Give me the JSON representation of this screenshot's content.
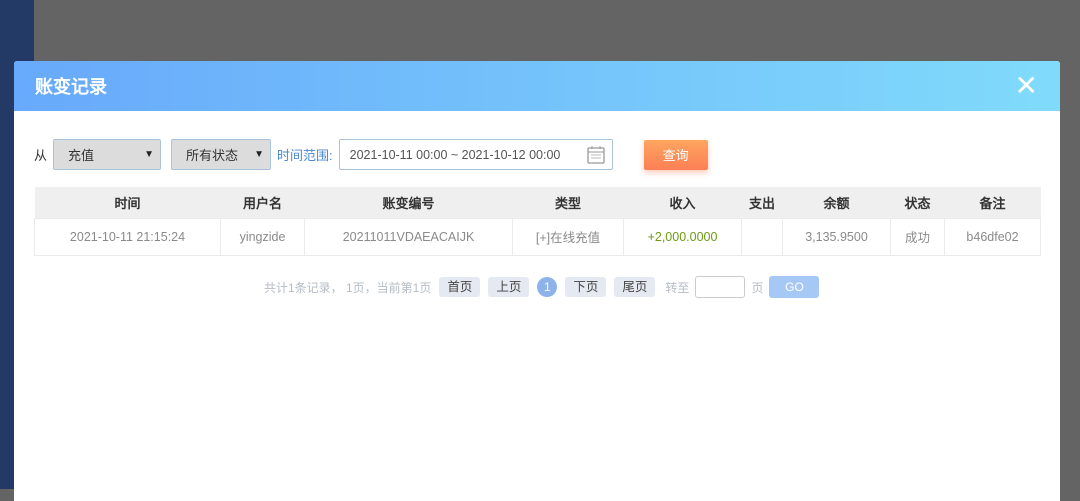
{
  "modal": {
    "title": "账变记录",
    "close_icon": "close-icon"
  },
  "filters": {
    "from_label": "从",
    "type_value": "充值",
    "status_value": "所有状态",
    "range_label": "时间范围:",
    "date_range": "2021-10-11 00:00 ~ 2021-10-12 00:00",
    "query_label": "查询"
  },
  "table": {
    "headers": [
      "时间",
      "用户名",
      "账变编号",
      "类型",
      "收入",
      "支出",
      "余额",
      "状态",
      "备注"
    ],
    "rows": [
      [
        "2021-10-11 21:15:24",
        "yingzide",
        "20211011VDAEACAIJK",
        "[+]在线充值",
        "+2,000.0000",
        "",
        "3,135.9500",
        "成功",
        "b46dfe02"
      ]
    ]
  },
  "pager": {
    "summary": "共计1条记录， 1页，当前第1页",
    "first": "首页",
    "prev": "上页",
    "current": "1",
    "next": "下页",
    "last": "尾页",
    "goto": "转至",
    "page_unit": "页",
    "go": "GO",
    "input_value": ""
  },
  "colors": {
    "header_start": "#68a9fb",
    "header_end": "#80dbfb",
    "query": "#fd8f58",
    "income": "#6d9a12"
  }
}
